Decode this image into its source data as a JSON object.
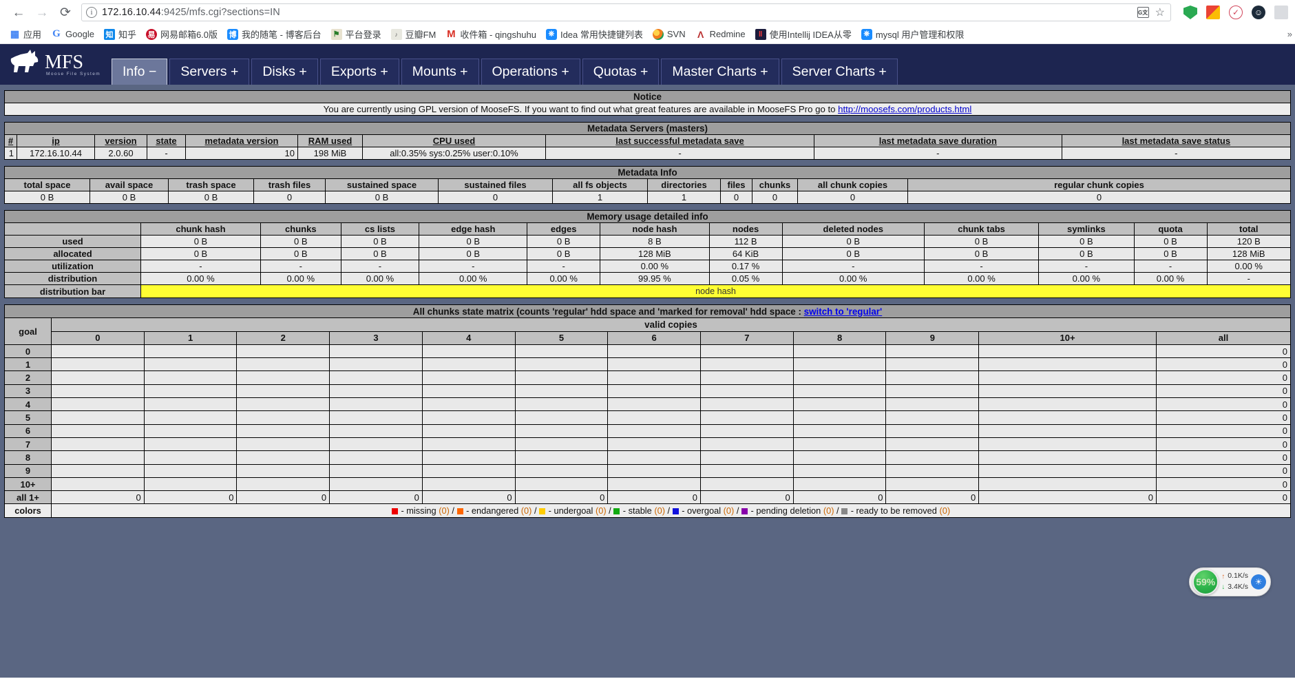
{
  "browser": {
    "back_icon": "back-arrow-icon",
    "forward_icon": "forward-arrow-icon",
    "reload_icon": "reload-icon",
    "url_host": "172.16.10.44",
    "url_rest": ":9425/mfs.cgi?sections=IN",
    "translate_icon_label": "G文",
    "star_icon": "☆",
    "overflow": "»",
    "bookmarks": [
      {
        "label": "应用",
        "icon": "apps-grid-icon",
        "cls": "ic-apps",
        "glyph": "∷"
      },
      {
        "label": "Google",
        "icon": "google-icon",
        "cls": "ic-g",
        "glyph": "G"
      },
      {
        "label": "知乎",
        "icon": "zhihu-icon",
        "cls": "ic-zhihu",
        "glyph": "知"
      },
      {
        "label": "网易邮箱6.0版",
        "icon": "netease-mail-icon",
        "cls": "ic-163",
        "glyph": "易"
      },
      {
        "label": "我的随笔 - 博客后台",
        "icon": "blog-icon",
        "cls": "ic-blog",
        "glyph": "博"
      },
      {
        "label": "平台登录",
        "icon": "platform-login-icon",
        "cls": "ic-pt",
        "glyph": "⚑"
      },
      {
        "label": "豆瓣FM",
        "icon": "douban-fm-icon",
        "cls": "ic-douban",
        "glyph": "♪"
      },
      {
        "label": "收件箱 - qingshuhu",
        "icon": "gmail-icon",
        "cls": "ic-gm",
        "glyph": "M"
      },
      {
        "label": "Idea 常用快捷键列表",
        "icon": "idea-shortcuts-icon",
        "cls": "ic-idea",
        "glyph": "⎇"
      },
      {
        "label": "SVN",
        "icon": "svn-icon",
        "cls": "ic-svn",
        "glyph": ""
      },
      {
        "label": "Redmine",
        "icon": "redmine-icon",
        "cls": "ic-redmine",
        "glyph": "Λ"
      },
      {
        "label": "使用Intellij IDEA从零",
        "icon": "intellij-book-icon",
        "cls": "ic-ij",
        "glyph": "‖"
      },
      {
        "label": "mysql 用户管理和权限",
        "icon": "mysql-icon",
        "cls": "ic-mysql",
        "glyph": "⎇"
      }
    ],
    "extensions": [
      {
        "name": "adblock-shield-icon",
        "cls": "shield",
        "glyph": ""
      },
      {
        "name": "download-helper-icon",
        "cls": "down",
        "glyph": ""
      },
      {
        "name": "clock-icon",
        "cls": "clock",
        "glyph": "✔"
      },
      {
        "name": "profile-face-icon",
        "cls": "face",
        "glyph": "☺"
      },
      {
        "name": "qr-grid-icon",
        "cls": "grid",
        "glyph": ""
      }
    ]
  },
  "mfs": {
    "logo_title": "MFS",
    "logo_subtitle": "Moose File System",
    "nav": [
      {
        "label": "Info −",
        "active": true
      },
      {
        "label": "Servers +",
        "active": false
      },
      {
        "label": "Disks +",
        "active": false
      },
      {
        "label": "Exports +",
        "active": false
      },
      {
        "label": "Mounts +",
        "active": false
      },
      {
        "label": "Operations +",
        "active": false
      },
      {
        "label": "Quotas +",
        "active": false
      },
      {
        "label": "Master Charts +",
        "active": false
      },
      {
        "label": "Server Charts +",
        "active": false
      }
    ],
    "notice": {
      "title": "Notice",
      "text_before": "You are currently using GPL version of MooseFS. If you want to find out what great features are available in MooseFS Pro go to ",
      "link": "http://moosefs.com/products.html"
    },
    "masters": {
      "title": "Metadata Servers (masters)",
      "headers": [
        "#",
        "ip",
        "version",
        "state",
        "metadata version",
        "RAM used",
        "CPU used",
        "last successful metadata save",
        "last metadata save duration",
        "last metadata save status"
      ],
      "row": [
        "1",
        "172.16.10.44",
        "2.0.60",
        "-",
        "10",
        "198 MiB",
        "all:0.35% sys:0.25% user:0.10%",
        "-",
        "-",
        "-"
      ]
    },
    "metadata_info": {
      "title": "Metadata Info",
      "headers": [
        "total space",
        "avail space",
        "trash space",
        "trash files",
        "sustained space",
        "sustained files",
        "all fs objects",
        "directories",
        "files",
        "chunks",
        "all chunk copies",
        "regular chunk copies"
      ],
      "row": [
        "0 B",
        "0 B",
        "0 B",
        "0",
        "0 B",
        "0",
        "1",
        "1",
        "0",
        "0",
        "0",
        "0"
      ]
    },
    "memory": {
      "title": "Memory usage detailed info",
      "headers": [
        "",
        "chunk hash",
        "chunks",
        "cs lists",
        "edge hash",
        "edges",
        "node hash",
        "nodes",
        "deleted nodes",
        "chunk tabs",
        "symlinks",
        "quota",
        "total"
      ],
      "rows": [
        {
          "label": "used",
          "values": [
            "0 B",
            "0 B",
            "0 B",
            "0 B",
            "0 B",
            "8 B",
            "112 B",
            "0 B",
            "0 B",
            "0 B",
            "0 B",
            "120 B"
          ]
        },
        {
          "label": "allocated",
          "values": [
            "0 B",
            "0 B",
            "0 B",
            "0 B",
            "0 B",
            "128 MiB",
            "64 KiB",
            "0 B",
            "0 B",
            "0 B",
            "0 B",
            "128 MiB"
          ]
        },
        {
          "label": "utilization",
          "values": [
            "-",
            "-",
            "-",
            "-",
            "-",
            "0.00 %",
            "0.17 %",
            "-",
            "-",
            "-",
            "-",
            "0.00 %"
          ]
        },
        {
          "label": "distribution",
          "values": [
            "0.00 %",
            "0.00 %",
            "0.00 %",
            "0.00 %",
            "0.00 %",
            "99.95 %",
            "0.05 %",
            "0.00 %",
            "0.00 %",
            "0.00 %",
            "0.00 %",
            "-"
          ]
        }
      ],
      "dist_bar_label": "distribution bar",
      "dist_bar_segment": "node hash",
      "dist_bar_color": "#ffff33"
    },
    "matrix": {
      "title_before": "All chunks state matrix (counts 'regular' hdd space and 'marked for removal' hdd space : ",
      "title_link": "switch to 'regular'",
      "goal_label": "goal",
      "valid_copies_label": "valid copies",
      "columns": [
        "0",
        "1",
        "2",
        "3",
        "4",
        "5",
        "6",
        "7",
        "8",
        "9",
        "10+",
        "all"
      ],
      "rows": [
        {
          "goal": "0",
          "values": [
            "",
            "",
            "",
            "",
            "",
            "",
            "",
            "",
            "",
            "",
            "",
            "0"
          ]
        },
        {
          "goal": "1",
          "values": [
            "",
            "",
            "",
            "",
            "",
            "",
            "",
            "",
            "",
            "",
            "",
            "0"
          ]
        },
        {
          "goal": "2",
          "values": [
            "",
            "",
            "",
            "",
            "",
            "",
            "",
            "",
            "",
            "",
            "",
            "0"
          ]
        },
        {
          "goal": "3",
          "values": [
            "",
            "",
            "",
            "",
            "",
            "",
            "",
            "",
            "",
            "",
            "",
            "0"
          ]
        },
        {
          "goal": "4",
          "values": [
            "",
            "",
            "",
            "",
            "",
            "",
            "",
            "",
            "",
            "",
            "",
            "0"
          ]
        },
        {
          "goal": "5",
          "values": [
            "",
            "",
            "",
            "",
            "",
            "",
            "",
            "",
            "",
            "",
            "",
            "0"
          ]
        },
        {
          "goal": "6",
          "values": [
            "",
            "",
            "",
            "",
            "",
            "",
            "",
            "",
            "",
            "",
            "",
            "0"
          ]
        },
        {
          "goal": "7",
          "values": [
            "",
            "",
            "",
            "",
            "",
            "",
            "",
            "",
            "",
            "",
            "",
            "0"
          ]
        },
        {
          "goal": "8",
          "values": [
            "",
            "",
            "",
            "",
            "",
            "",
            "",
            "",
            "",
            "",
            "",
            "0"
          ]
        },
        {
          "goal": "9",
          "values": [
            "",
            "",
            "",
            "",
            "",
            "",
            "",
            "",
            "",
            "",
            "",
            "0"
          ]
        },
        {
          "goal": "10+",
          "values": [
            "",
            "",
            "",
            "",
            "",
            "",
            "",
            "",
            "",
            "",
            "",
            "0"
          ]
        },
        {
          "goal": "all 1+",
          "values": [
            "0",
            "0",
            "0",
            "0",
            "0",
            "0",
            "0",
            "0",
            "0",
            "0",
            "0",
            "0"
          ]
        }
      ],
      "colors_label": "colors",
      "legend": [
        {
          "color": "#ee0000",
          "label": "missing",
          "count": "0"
        },
        {
          "color": "#ff6600",
          "label": "endangered",
          "count": "0"
        },
        {
          "color": "#ffcc00",
          "label": "undergoal",
          "count": "0"
        },
        {
          "color": "#11aa11",
          "label": "stable",
          "count": "0"
        },
        {
          "color": "#1111dd",
          "label": "overgoal",
          "count": "0"
        },
        {
          "color": "#8800aa",
          "label": "pending deletion",
          "count": "0"
        },
        {
          "color": "#888888",
          "label": "ready to be removed",
          "count": "0"
        }
      ]
    }
  },
  "speed_widget": {
    "percent": "59%",
    "up_rate": "0.1K/s",
    "down_rate": "3.4K/s",
    "up_icon": "upload-arrow-icon",
    "down_icon": "download-arrow-icon",
    "globe_icon": "globe-icon"
  }
}
